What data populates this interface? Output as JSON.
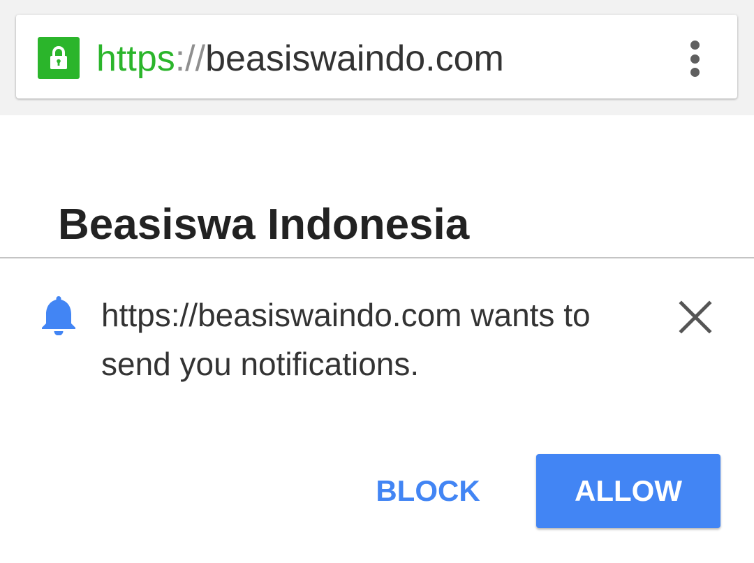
{
  "browser": {
    "url": {
      "scheme": "https",
      "separator": "://",
      "host": "beasiswaindo.com"
    },
    "secure_icon": "lock-icon",
    "menu_icon": "more-vert-icon",
    "secure_color": "#2bb52b"
  },
  "page": {
    "title": "Beasiswa Indonesia"
  },
  "permission_prompt": {
    "icon": "bell-icon",
    "message": "https://beasiswaindo.com wants to send you notifications.",
    "close_icon": "close-icon",
    "block_label": "BLOCK",
    "allow_label": "ALLOW",
    "accent_color": "#4285f4"
  }
}
